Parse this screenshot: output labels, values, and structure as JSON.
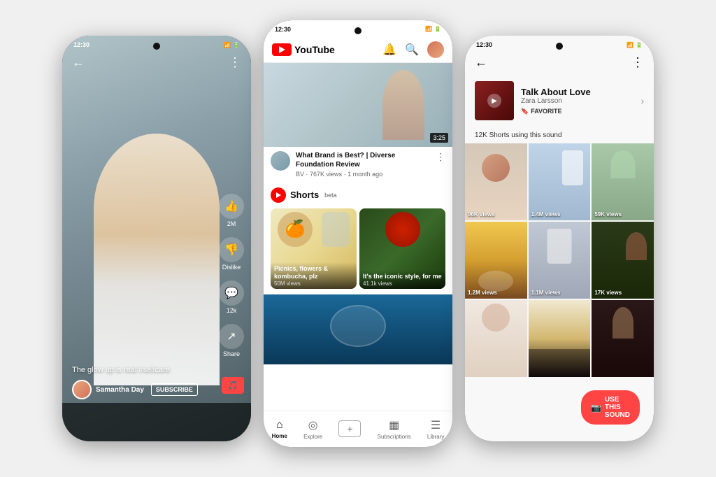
{
  "phone1": {
    "status": {
      "time": "12:30"
    },
    "caption": "The glow up is real #selfcare",
    "user": "Samantha Day",
    "subscribe": "SUBSCRIBE",
    "actions": [
      {
        "icon": "👍",
        "label": "2M"
      },
      {
        "icon": "👎",
        "label": "Dislike"
      },
      {
        "icon": "💬",
        "label": "12k"
      },
      {
        "icon": "↗",
        "label": "Share"
      }
    ]
  },
  "phone2": {
    "status": {
      "time": "12:30"
    },
    "logo": "YouTube",
    "video": {
      "title": "What Brand is Best? | Diverse Foundation Review",
      "channel": "BV",
      "views": "767K views",
      "age": "1 month ago",
      "duration": "3:25"
    },
    "shorts": {
      "label": "Shorts",
      "beta": "beta",
      "items": [
        {
          "title": "Picnics, flowers & kombucha, plz",
          "views": "50M views"
        },
        {
          "title": "It's the iconic style, for me",
          "views": "41.1k views"
        }
      ]
    },
    "nav": [
      {
        "label": "Home",
        "icon": "⌂",
        "active": true
      },
      {
        "label": "Explore",
        "icon": "◎",
        "active": false
      },
      {
        "label": "+",
        "active": false
      },
      {
        "label": "Subscriptions",
        "icon": "▦",
        "active": false
      },
      {
        "label": "Library",
        "icon": "☰",
        "active": false
      }
    ]
  },
  "phone3": {
    "status": {
      "time": "12:30"
    },
    "sound": {
      "title": "Talk About Love",
      "artist": "Zara Larsson",
      "favorite": "FAVORITE",
      "count": "12K Shorts using this sound"
    },
    "grid": [
      {
        "views": "96K views"
      },
      {
        "views": "1.4M views"
      },
      {
        "views": "59K views"
      },
      {
        "views": "1.2M views"
      },
      {
        "views": "1.1M views"
      },
      {
        "views": "17K views"
      }
    ],
    "use_sound": "USE THIS SOUND"
  }
}
